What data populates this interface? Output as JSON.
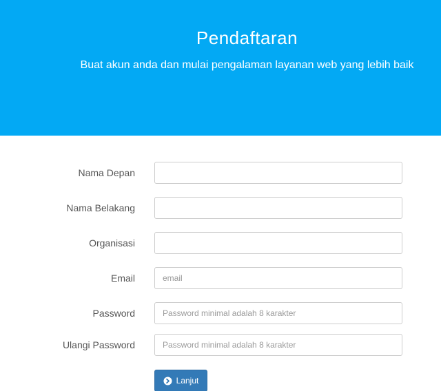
{
  "header": {
    "title": "Pendaftaran",
    "subtitle": "Buat akun anda dan mulai pengalaman layanan web yang lebih baik"
  },
  "form": {
    "fields": [
      {
        "label": "Nama Depan",
        "value": "",
        "placeholder": ""
      },
      {
        "label": "Nama Belakang",
        "value": "",
        "placeholder": ""
      },
      {
        "label": "Organisasi",
        "value": "",
        "placeholder": ""
      },
      {
        "label": "Email",
        "value": "",
        "placeholder": "email"
      },
      {
        "label": "Password",
        "value": "",
        "placeholder": "Password minimal adalah 8 karakter"
      },
      {
        "label": "Ulangi Password",
        "value": "",
        "placeholder": "Password minimal adalah 8 karakter"
      }
    ],
    "submit": {
      "label": "Lanjut",
      "icon": "arrow-right-circle-icon"
    }
  },
  "colors": {
    "header_background": "#03a9f4",
    "button_primary": "#337ab7"
  }
}
